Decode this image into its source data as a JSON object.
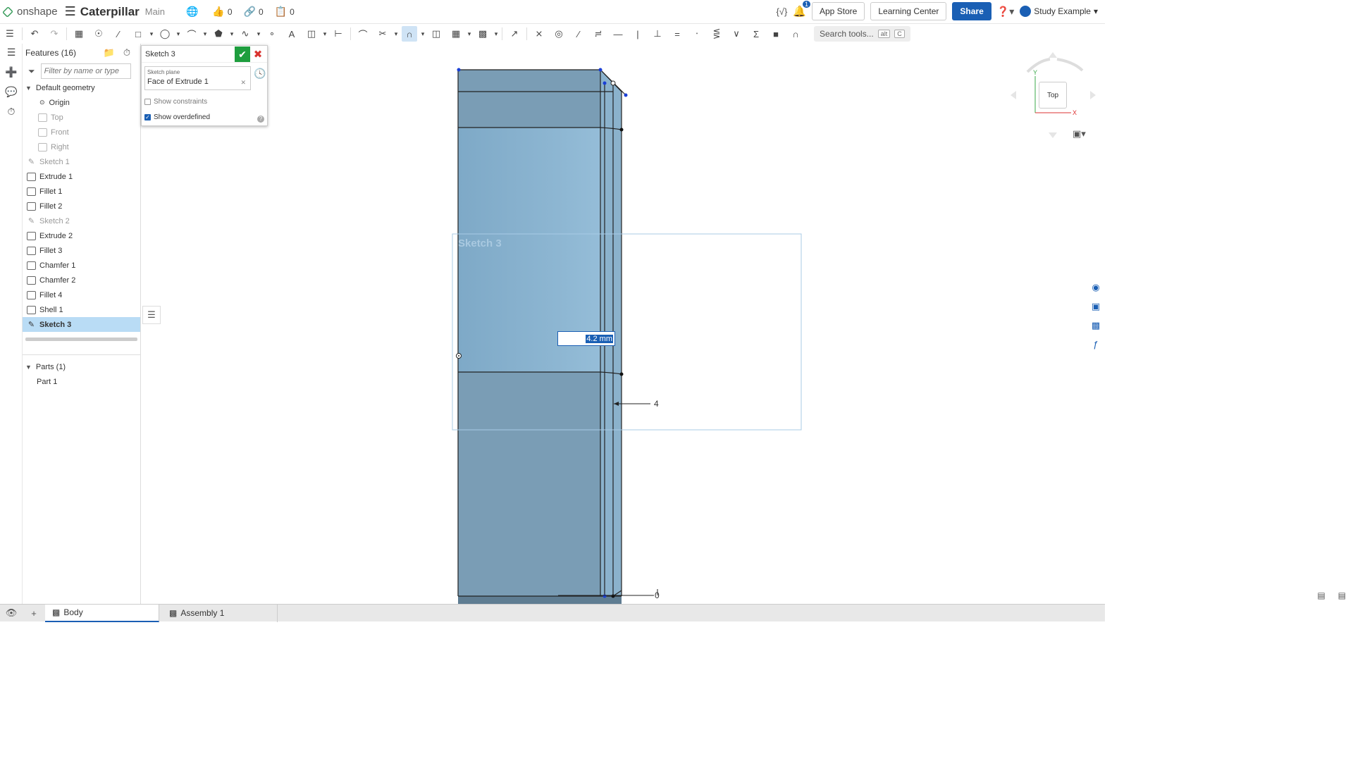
{
  "app": {
    "logo_text": "onshape",
    "document_title": "Caterpillar",
    "branch": "Main",
    "likes": "0",
    "links": "0",
    "copies": "0",
    "notification_count": "1",
    "app_store_label": "App Store",
    "learning_center_label": "Learning Center",
    "share_label": "Share",
    "user_name": "Study Example"
  },
  "toolbar": {
    "search_placeholder": "Search tools...",
    "search_kbd_1": "alt",
    "search_kbd_2": "C"
  },
  "features": {
    "title": "Features (16)",
    "filter_placeholder": "Filter by name or type",
    "default_geometry_label": "Default geometry",
    "default_items": [
      "Origin",
      "Top",
      "Front",
      "Right"
    ],
    "items": [
      {
        "label": "Sketch 1",
        "dim": true
      },
      {
        "label": "Extrude 1",
        "dim": false
      },
      {
        "label": "Fillet 1",
        "dim": false
      },
      {
        "label": "Fillet 2",
        "dim": false
      },
      {
        "label": "Sketch 2",
        "dim": true
      },
      {
        "label": "Extrude 2",
        "dim": false
      },
      {
        "label": "Fillet 3",
        "dim": false
      },
      {
        "label": "Chamfer 1",
        "dim": false
      },
      {
        "label": "Chamfer 2",
        "dim": false
      },
      {
        "label": "Fillet 4",
        "dim": false
      },
      {
        "label": "Shell 1",
        "dim": false
      },
      {
        "label": "Sketch 3",
        "dim": false,
        "selected": true
      }
    ],
    "parts_label": "Parts (1)",
    "parts": [
      "Part 1"
    ]
  },
  "sketch_dialog": {
    "title": "Sketch 3",
    "plane_label": "Sketch plane",
    "plane_value": "Face of Extrude 1",
    "show_constraints_label": "Show constraints",
    "show_constraints_checked": false,
    "show_overdefined_label": "Show overdefined",
    "show_overdefined_checked": true
  },
  "viewport": {
    "sketch_name_label": "Sketch 3",
    "dimension_input_value": "4.2 mm",
    "dimension_label_4": "4",
    "dimension_label_0": "0"
  },
  "view_cube": {
    "face_label": "Top",
    "axis_y": "Y",
    "axis_x": "X"
  },
  "bottom_tabs": {
    "body_label": "Body",
    "assembly_label": "Assembly 1"
  },
  "colors": {
    "share_blue": "#1a5fb4",
    "part_blue": "#86b2cf",
    "part_dark": "#7a9db5",
    "selection_blue": "#b9dcf5",
    "confirm_green": "#1e9e3e"
  }
}
